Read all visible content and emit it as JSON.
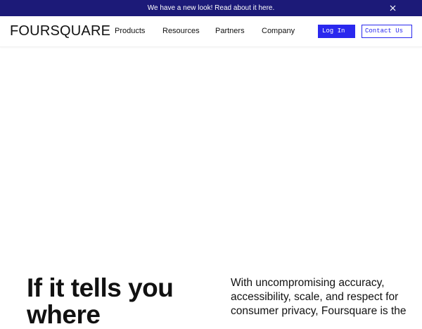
{
  "announcement": {
    "text": "We have a new look! Read about it here.",
    "close_icon": "close-icon"
  },
  "nav": {
    "logo": "FOURSQUARE",
    "items": [
      {
        "label": "Products"
      },
      {
        "label": "Resources"
      },
      {
        "label": "Partners"
      },
      {
        "label": "Company"
      }
    ],
    "login_label": "Log In",
    "contact_label": "Contact Us"
  },
  "hero": {
    "title": "If it tells you where",
    "body": "With uncompromising accuracy, accessibility, scale, and respect for consumer privacy, Foursquare is the"
  },
  "colors": {
    "announcement_bg": "#1c1a78",
    "accent": "#2a28ee",
    "text": "#111111"
  }
}
